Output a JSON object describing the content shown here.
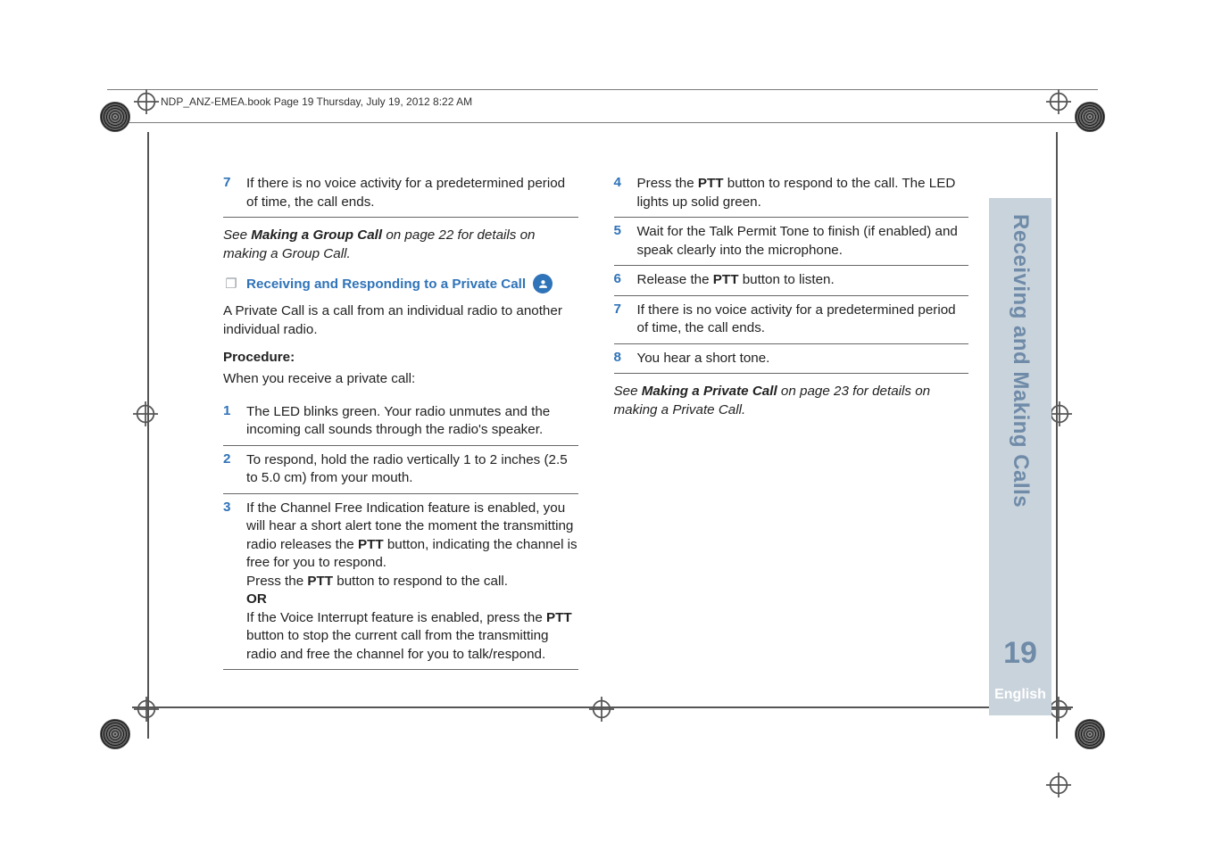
{
  "header": {
    "running_head": "NDP_ANZ-EMEA.book  Page 19  Thursday, July 19, 2012  8:22 AM"
  },
  "sidebar": {
    "section_title": "Receiving and Making Calls",
    "page_number": "19",
    "language": "English"
  },
  "left_col": {
    "carry_step": {
      "num": "7",
      "text": "If there is no voice activity for a predetermined period of time, the call ends."
    },
    "see_group_pre": "See ",
    "see_group_link": "Making a Group Call",
    "see_group_post": " on page 22 for details on making a Group Call.",
    "subhead": "Receiving and Responding to a Private Call",
    "intro": "A Private Call is a call from an individual radio to another individual radio.",
    "procedure_label": "Procedure:",
    "procedure_intro": "When you receive a private call:",
    "steps": [
      {
        "num": "1",
        "text": "The LED blinks green. Your radio unmutes and the incoming call sounds through the radio's speaker."
      },
      {
        "num": "2",
        "text": "To respond, hold the radio vertically 1 to 2 inches (2.5 to 5.0 cm) from your mouth."
      },
      {
        "num": "3",
        "pre1": "If the Channel Free Indication feature is enabled, you will hear a short alert tone the moment the transmitting radio releases the ",
        "ptt1": "PTT",
        "mid1": " button, indicating the channel is free for you to respond.",
        "line2_pre": "Press the ",
        "line2_ptt": "PTT",
        "line2_post": " button to respond to the call.",
        "or": "OR",
        "alt_pre": "If the Voice Interrupt feature is enabled, press the ",
        "alt_ptt": "PTT",
        "alt_post": " button to stop the current call from the transmitting radio and free the channel for you to talk/respond."
      }
    ]
  },
  "right_col": {
    "steps": [
      {
        "num": "4",
        "pre": "Press the ",
        "ptt": "PTT",
        "post": " button to respond to the call. The LED lights up solid green."
      },
      {
        "num": "5",
        "text": "Wait for the Talk Permit Tone to finish (if enabled) and speak clearly into the microphone."
      },
      {
        "num": "6",
        "pre": "Release the ",
        "ptt": "PTT",
        "post": " button to listen."
      },
      {
        "num": "7",
        "text": "If there is no voice activity for a predetermined period of time, the call ends."
      },
      {
        "num": "8",
        "text": "You hear a short tone."
      }
    ],
    "see_private_pre": "See ",
    "see_private_link": "Making a Private Call",
    "see_private_post": " on page 23 for details on making a Private Call."
  }
}
